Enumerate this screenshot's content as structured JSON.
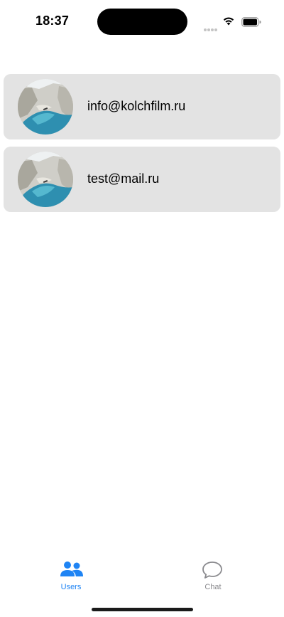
{
  "status_bar": {
    "time": "18:37",
    "icons": [
      "cellular-signal-icon",
      "wifi-icon",
      "battery-icon"
    ]
  },
  "users": [
    {
      "email": "info@kolchfilm.ru",
      "avatar": "beach-cove-photo"
    },
    {
      "email": "test@mail.ru",
      "avatar": "beach-cove-photo"
    }
  ],
  "tab_bar": {
    "tabs": [
      {
        "label": "Users",
        "icon": "people-icon",
        "selected": true,
        "color": "#1f84f4"
      },
      {
        "label": "Chat",
        "icon": "chat-bubble-icon",
        "selected": false,
        "color": "#8a8a8e"
      }
    ]
  },
  "colors": {
    "card_background": "#e3e3e3",
    "accent": "#1f84f4"
  }
}
